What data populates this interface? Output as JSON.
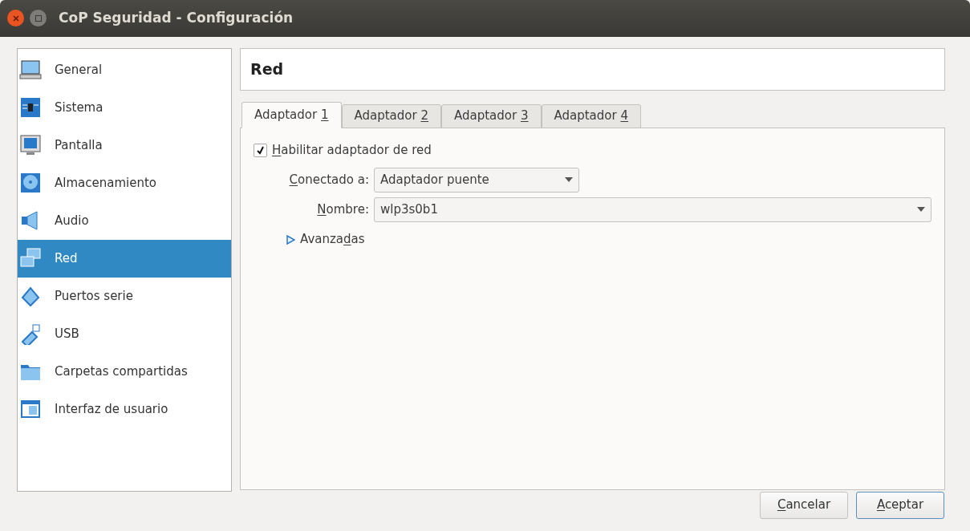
{
  "window": {
    "title": "CoP Seguridad - Configuración"
  },
  "sidebar": {
    "items": [
      {
        "label": "General",
        "selected": false
      },
      {
        "label": "Sistema",
        "selected": false
      },
      {
        "label": "Pantalla",
        "selected": false
      },
      {
        "label": "Almacenamiento",
        "selected": false
      },
      {
        "label": "Audio",
        "selected": false
      },
      {
        "label": "Red",
        "selected": true
      },
      {
        "label": "Puertos serie",
        "selected": false
      },
      {
        "label": "USB",
        "selected": false
      },
      {
        "label": "Carpetas compartidas",
        "selected": false
      },
      {
        "label": "Interfaz de usuario",
        "selected": false
      }
    ]
  },
  "page_title": "Red",
  "tabs": [
    {
      "label": {
        "pre": "Adaptador ",
        "key": "1"
      },
      "selected": true
    },
    {
      "label": {
        "pre": "Adaptador ",
        "key": "2"
      },
      "selected": false
    },
    {
      "label": {
        "pre": "Adaptador ",
        "key": "3"
      },
      "selected": false
    },
    {
      "label": {
        "pre": "Adaptador ",
        "key": "4"
      },
      "selected": false
    }
  ],
  "enable": {
    "label": {
      "key": "H",
      "post": "abilitar adaptador de red"
    },
    "checked": true
  },
  "attached": {
    "label": {
      "key": "C",
      "post": "onectado a:"
    },
    "value": "Adaptador puente"
  },
  "name": {
    "label": {
      "key": "N",
      "post": "ombre:"
    },
    "value": "wlp3s0b1"
  },
  "advanced": {
    "label": {
      "pre": "Avanza",
      "key": "d",
      "post": "as"
    },
    "expanded": false
  },
  "buttons": [
    {
      "label": {
        "key": "C",
        "post": "ancelar"
      },
      "default": false
    },
    {
      "label": {
        "key": "A",
        "post": "ceptar"
      },
      "default": true
    }
  ]
}
